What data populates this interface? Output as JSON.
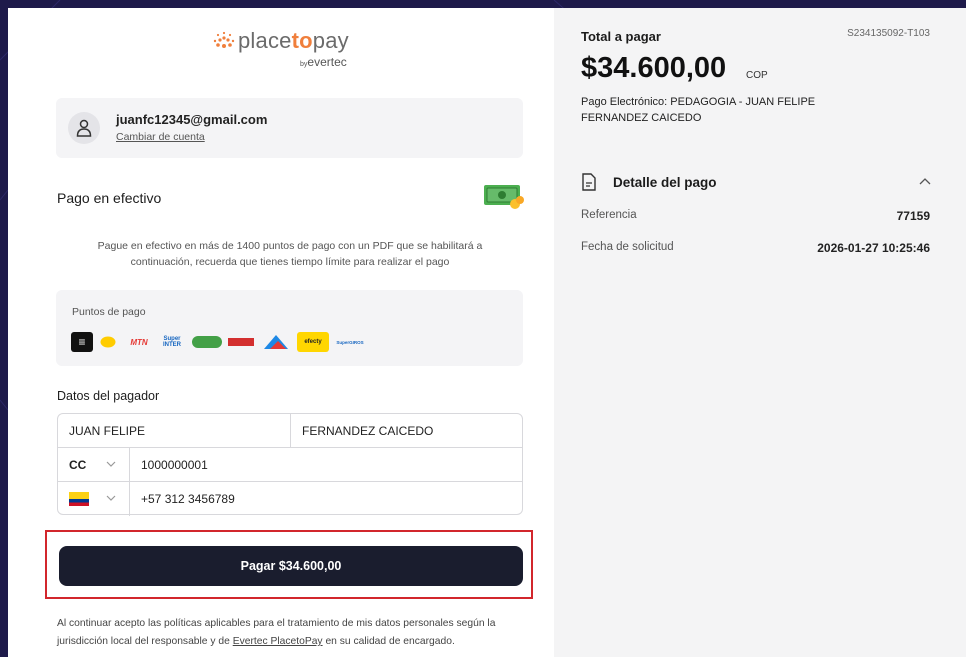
{
  "logo": {
    "main_a": "place",
    "main_b": "to",
    "main_c": "pay",
    "sub_by": "by",
    "sub_brand": "evertec"
  },
  "account": {
    "email": "juanfc12345@gmail.com",
    "change_label": "Cambiar de cuenta"
  },
  "payment_method": {
    "title": "Pago en efectivo",
    "description": "Pague en efectivo en más de 1400 puntos de pago con un PDF que se habilitará a continuación, recuerda que tienes tiempo límite para realizar el pago"
  },
  "points": {
    "label": "Puntos de pago",
    "brands": [
      "brand-1",
      "brand-2",
      "MTN",
      "Super INTER",
      "Gana",
      "brand-6",
      "brand-7",
      "efecty",
      "SuperGIROS"
    ]
  },
  "payer": {
    "title": "Datos del pagador",
    "first_name": "JUAN FELIPE",
    "last_name": "FERNANDEZ CAICEDO",
    "doc_type": "CC",
    "doc_number": "1000000001",
    "phone": "+57 312 3456789"
  },
  "pay_button": {
    "label": "Pagar $34.600,00"
  },
  "terms": {
    "text_1": "Al continuar acepto las políticas aplicables para el tratamiento de mis datos personales según la jurisdicción local del responsable y de ",
    "link": "Evertec PlacetoPay",
    "text_2": " en su calidad de encargado."
  },
  "summary": {
    "total_label": "Total a pagar",
    "order_code": "S234135092-T103",
    "amount": "$34.600,00",
    "currency": "COP",
    "merchant": "Pago Electrónico: PEDAGOGIA - JUAN FELIPE FERNANDEZ CAICEDO",
    "detail_title": "Detalle del pago",
    "rows": [
      {
        "label": "Referencia",
        "value": "77159"
      },
      {
        "label": "Fecha de solicitud",
        "value": "2026-01-27 10:25:46"
      }
    ]
  },
  "colors": {
    "background": "#1e1a4a",
    "accent": "#f07f3c",
    "button": "#1a1d2e",
    "highlight": "#d2262c"
  }
}
